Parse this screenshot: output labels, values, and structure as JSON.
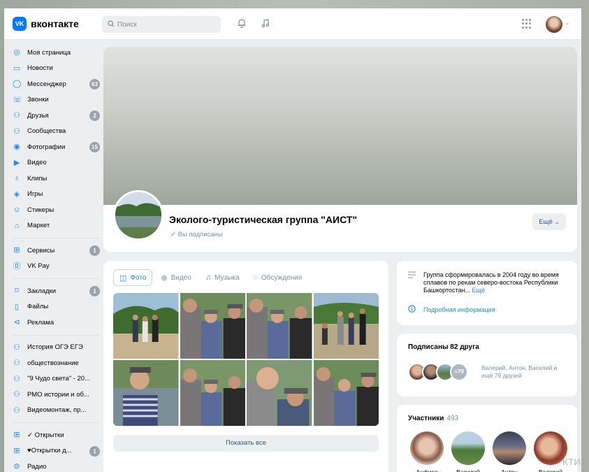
{
  "header": {
    "logo_mark": "VK",
    "logo_text": "вконтакте",
    "search_placeholder": "Поиск"
  },
  "sidebar": {
    "group1": [
      {
        "label": "Моя страница",
        "icon": "user-circle-icon"
      },
      {
        "label": "Новости",
        "icon": "news-icon"
      },
      {
        "label": "Мессенджер",
        "icon": "message-icon",
        "badge": "63"
      },
      {
        "label": "Звонки",
        "icon": "phone-icon"
      },
      {
        "label": "Друзья",
        "icon": "friends-icon",
        "badge": "2"
      },
      {
        "label": "Сообщества",
        "icon": "communities-icon"
      },
      {
        "label": "Фотографии",
        "icon": "photos-icon",
        "badge": "15"
      },
      {
        "label": "Видео",
        "icon": "video-icon"
      },
      {
        "label": "Клипы",
        "icon": "clips-icon"
      },
      {
        "label": "Игры",
        "icon": "games-icon"
      },
      {
        "label": "Стикеры",
        "icon": "stickers-icon"
      },
      {
        "label": "Маркет",
        "icon": "market-icon"
      }
    ],
    "group2": [
      {
        "label": "Сервисы",
        "icon": "services-icon",
        "badge": "1"
      },
      {
        "label": "VK Pay",
        "icon": "vkpay-icon"
      }
    ],
    "group3": [
      {
        "label": "Закладки",
        "icon": "bookmark-icon",
        "badge": "1"
      },
      {
        "label": "Файлы",
        "icon": "file-icon"
      },
      {
        "label": "Реклама",
        "icon": "ads-icon"
      }
    ],
    "group4": [
      {
        "label": "История ОГЭ ЕГЭ",
        "icon": "community-icon"
      },
      {
        "label": "обществознание",
        "icon": "community-icon"
      },
      {
        "label": "\"9 Чудо света\" - 20...",
        "icon": "community-icon"
      },
      {
        "label": "РМО истории и об...",
        "icon": "community-icon"
      },
      {
        "label": "Видеомонтаж, пр...",
        "icon": "community-icon"
      }
    ],
    "group5": [
      {
        "label": "✓ Открытки",
        "icon": "app-icon"
      },
      {
        "label": "♥Открытки д...",
        "icon": "app-icon",
        "badge": "1"
      },
      {
        "label": "Радио",
        "icon": "radio-icon"
      }
    ]
  },
  "group": {
    "name": "Эколого-туристическая группа \"АИСТ\"",
    "status": "Вы подписаны",
    "more_button": "Ещё"
  },
  "media": {
    "tabs": [
      {
        "label": "Фото",
        "icon": "photo-icon",
        "active": true
      },
      {
        "label": "Видео",
        "icon": "video-icon",
        "active": false
      },
      {
        "label": "Музыка",
        "icon": "music-icon",
        "active": false
      },
      {
        "label": "Обсуждения",
        "icon": "discussion-icon",
        "active": false
      }
    ],
    "show_all": "Показать все"
  },
  "info": {
    "description": "Группа сформировалась в 2004 году во время сплавов по рекам северо-востока Республики Башкортостан...",
    "description_more": "Ещё",
    "details_link": "Подробная информация"
  },
  "friends": {
    "title": "Подписаны 82 друга",
    "more_count": "+79",
    "text": "Валерий, Антон, Василий и ещё 79 друзей"
  },
  "members": {
    "title": "Участники",
    "count": "493",
    "list": [
      {
        "name": "Анфиса"
      },
      {
        "name": "Василий"
      },
      {
        "name": "Антон"
      },
      {
        "name": "Валерий"
      }
    ]
  },
  "watermark": "КТИ",
  "colors": {
    "accent": "#2688eb",
    "brand": "#0077ff",
    "badge": "#99a2ad"
  }
}
